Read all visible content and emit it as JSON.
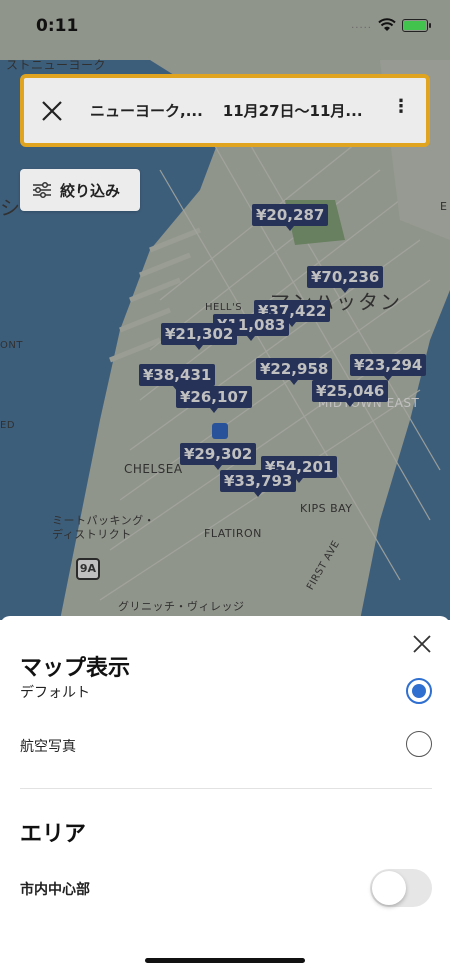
{
  "status_bar": {
    "time": "0:11",
    "dots": "....."
  },
  "search": {
    "location": "ニューヨーク,...",
    "dates": "11月27日〜11月...",
    "more": "⋮"
  },
  "filter": {
    "label": "絞り込み"
  },
  "map": {
    "labels": {
      "top": "ストニューヨーク",
      "manhattan": "マンハッタン",
      "hells": "HELL'S",
      "chelsea": "CHELSEA",
      "midtown_east": "MIDTOWN EAST",
      "kips_bay": "KIPS BAY",
      "flatiron": "FLATIRON",
      "meatpacking": "ミートパッキング・\nディストリクト",
      "greenwich": "グリニッチ・ヴィレッジ",
      "first_ave": "FIRST AVE",
      "route": "9A",
      "ont": "ONT",
      "ed": "ED",
      "edge_e": "E",
      "edge_shi": "シ"
    },
    "prices": [
      "¥20,287",
      "¥70,236",
      "¥37,422",
      "¥11,083",
      "¥21,302",
      "¥22,958",
      "¥23,294",
      "¥38,431",
      "¥25,046",
      "¥26,107",
      "¥29,302",
      "¥54,201",
      "¥33,793"
    ]
  },
  "sheet": {
    "map_display_title": "マップ表示",
    "option_default": "デフォルト",
    "option_aerial": "航空写真",
    "selected": "default",
    "area_title": "エリア",
    "area_option": "市内中心部",
    "area_enabled": false
  },
  "colors": {
    "accent": "#2f6fd0",
    "highlight_border": "#e0a420",
    "price_bg": "#1d2f66"
  }
}
